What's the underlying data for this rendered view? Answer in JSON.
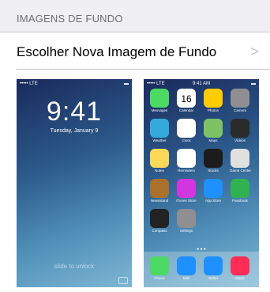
{
  "section": {
    "header": "IMAGENS DE FUNDO"
  },
  "row": {
    "label": "Escolher Nova Imagem de Fundo",
    "chevron": ">"
  },
  "lock": {
    "status_left": "••••• LTE",
    "time": "9:41",
    "date": "Tuesday, January 9",
    "unlock": "slide to unlock"
  },
  "home": {
    "status_left": "••••• LTE",
    "status_time": "9:41 AM",
    "apps": [
      {
        "name": "Messages",
        "color": "#4cd964"
      },
      {
        "name": "Calendar",
        "color": "#ffffff"
      },
      {
        "name": "Photos",
        "color": "#ffcc00"
      },
      {
        "name": "Camera",
        "color": "#8e8e93"
      },
      {
        "name": "Weather",
        "color": "#34aadc"
      },
      {
        "name": "Clock",
        "color": "#ffffff"
      },
      {
        "name": "Maps",
        "color": "#7dc366"
      },
      {
        "name": "Videos",
        "color": "#2b2b2b"
      },
      {
        "name": "Notes",
        "color": "#ffd95a"
      },
      {
        "name": "Reminders",
        "color": "#ffffff"
      },
      {
        "name": "Stocks",
        "color": "#1c1c1c"
      },
      {
        "name": "Game Center",
        "color": "#e0e0e0"
      },
      {
        "name": "Newsstand",
        "color": "#a9712c"
      },
      {
        "name": "iTunes Store",
        "color": "#d335e0"
      },
      {
        "name": "App Store",
        "color": "#1e90ff"
      },
      {
        "name": "Passbook",
        "color": "#2fb24f"
      },
      {
        "name": "Compass",
        "color": "#222222"
      },
      {
        "name": "Settings",
        "color": "#8e8e93"
      }
    ],
    "calendar_day": "16",
    "dock": [
      {
        "name": "Phone",
        "color": "#4cd964"
      },
      {
        "name": "Mail",
        "color": "#1e90ff"
      },
      {
        "name": "Safari",
        "color": "#1e90ff"
      },
      {
        "name": "Music",
        "color": "#ff2d55"
      }
    ]
  }
}
